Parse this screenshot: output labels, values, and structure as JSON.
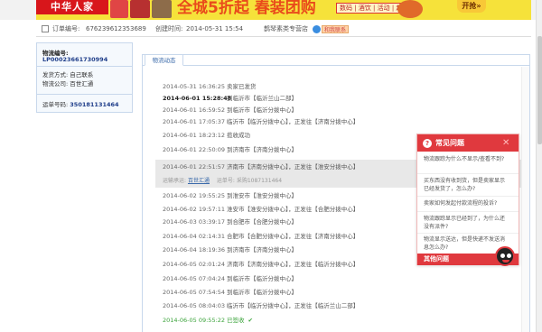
{
  "banner": {
    "logo": "中华人家",
    "slogan": "全城5折起 春装团购",
    "sub": "数码 | 酒饮 | 活动 | 超市",
    "button": "开抢»"
  },
  "order": {
    "number_label": "订单编号:",
    "number": "676239612353689",
    "created_label": "创建时间:",
    "created": "2014-05-31 15:54",
    "shop": "鹊琴素类专营店",
    "contact": "和我联系"
  },
  "logistics": {
    "no_label": "物流编号:",
    "no": "LP00023661730994",
    "method_label": "发货方式:",
    "method": "自己联系",
    "company_label": "物流公司:",
    "company": "百世汇通",
    "waybill_label": "运单号码:",
    "waybill": "350181131464"
  },
  "tab": "物流动态",
  "timeline": [
    {
      "time": "2014-05-31 16:36:25",
      "desc": "卖家已发货"
    },
    {
      "time": "2014-06-01 15:28:48",
      "desc": "到临沂市【临沂兰山二部】",
      "bold": true
    },
    {
      "time": "2014-06-01 16:59:52",
      "desc": "到临沂市【临沂分拨中心】"
    },
    {
      "time": "2014-06-01 17:05:37",
      "desc": "临沂市【临沂分拨中心】，正发往【济南分拨中心】"
    },
    {
      "time": "2014-06-01 18:23:12",
      "desc": "揽收成功"
    },
    {
      "time": "2014-06-01 22:50:09",
      "desc": "到济南市【济南分拨中心】"
    },
    {
      "time": "2014-06-01 22:51:57",
      "desc": "济南市【济南分拨中心】，正发往【淮安分拨中心】"
    },
    {
      "time": "2014-06-02 19:55:25",
      "desc": "到淮安市【淮安分拨中心】"
    },
    {
      "time": "2014-06-02 19:57:11",
      "desc": "淮安市【淮安分拨中心】，正发往【合肥分拨中心】"
    },
    {
      "time": "2014-06-03 03:39:17",
      "desc": "到合肥市【合肥分拨中心】"
    },
    {
      "time": "2014-06-04 02:14:31",
      "desc": "合肥市【合肥分拨中心】，正发往【济南分拨中心】"
    },
    {
      "time": "2014-06-04 18:19:36",
      "desc": "到济南市【济南分拨中心】"
    },
    {
      "time": "2014-06-05 02:01:24",
      "desc": "济南市【济南分拨中心】，正发往【临沂分拨中心】"
    },
    {
      "time": "2014-06-05 07:04:24",
      "desc": "到临沂市【临沂分拨中心】"
    },
    {
      "time": "2014-06-05 07:54:54",
      "desc": "到临沂市【临沂分拨中心】"
    },
    {
      "time": "2014-06-05 08:04:03",
      "desc": "临沂市【临沂分拨中心】，正发往【临沂兰山二部】"
    },
    {
      "time": "2014-06-05 09:55:22",
      "desc": "已签收"
    }
  ],
  "highlight": {
    "company_label": "运输承运:",
    "company": "百世汇通",
    "waybill_label": "运单号:",
    "waybill": "采购1087131464"
  },
  "faq": {
    "title": "常见问题",
    "items": [
      "物流跟踪为什么不显示/查看不到?",
      "买东西没有收到货，但是卖家显示已经发货了，怎么办?",
      "卖家如何发起付款流程的投诉?",
      "物流跟踪显示已经到了，为什么还没有派件?",
      "物流显示送达，但是快递不发送消息怎么办?"
    ],
    "more": "其他问题"
  }
}
